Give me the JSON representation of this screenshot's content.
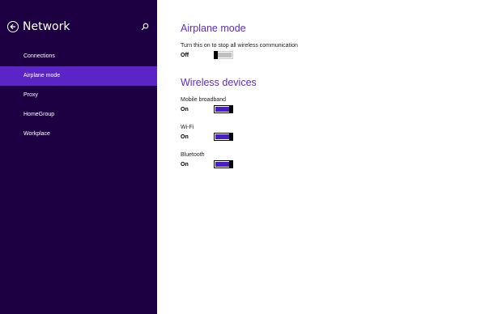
{
  "sidebar": {
    "title": "Network",
    "items": [
      {
        "label": "Connections"
      },
      {
        "label": "Airplane mode"
      },
      {
        "label": "Proxy"
      },
      {
        "label": "HomeGroup"
      },
      {
        "label": "Workplace"
      }
    ],
    "active_index": 1
  },
  "airplane": {
    "title": "Airplane mode",
    "description": "Turn this on to stop all wireless communication",
    "state": "Off"
  },
  "wireless": {
    "title": "Wireless devices",
    "devices": [
      {
        "label": "Mobile broadband",
        "state": "On"
      },
      {
        "label": "Wi-Fi",
        "state": "On"
      },
      {
        "label": "Bluetooth",
        "state": "On"
      }
    ]
  },
  "colors": {
    "sidebar_bg": "#1c0042",
    "active_item": "#5a24c7",
    "accent": "#5b2bd0",
    "toggle_on": "#4a1fbf"
  },
  "icons": {
    "back": "back-arrow-icon",
    "search": "search-icon"
  }
}
